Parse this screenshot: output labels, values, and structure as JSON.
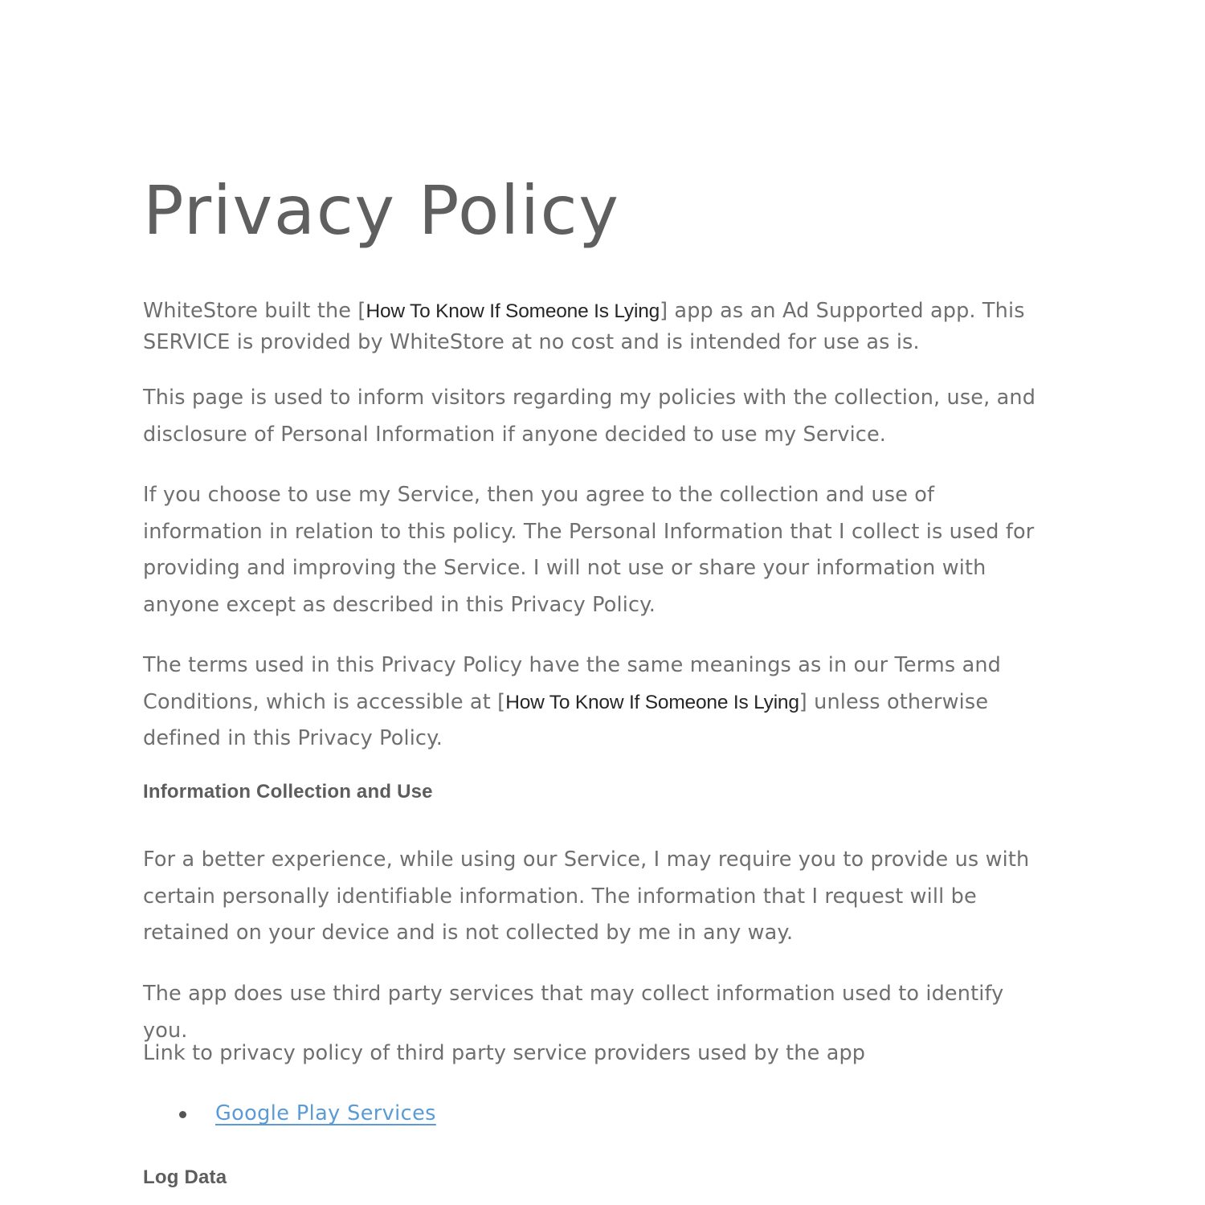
{
  "document": {
    "title": "Privacy Policy",
    "app_name": "How To Know If Someone Is Lying",
    "company": "WhiteStore",
    "colors": {
      "background": "#ffffff",
      "title": "#5f5f5f",
      "body_text": "#6f6f6f",
      "heading": "#5d5d5d",
      "app_name_text": "#262626",
      "link": "#5b9bd5",
      "bullet": "#555555"
    }
  },
  "paragraphs": {
    "intro_before": "WhiteStore built the [",
    "intro_after": "] app as an Ad Supported app. This SERVICE is provided by WhiteStore at no cost and is intended for use as is.",
    "p_inform": "This page is used to inform visitors regarding my policies with the collection, use, and disclosure of Personal Information if anyone decided to use my Service.",
    "p_choose": "If you choose to use my Service, then you agree to the collection and use of information in relation to this policy. The Personal Information that I collect is used for providing and improving the Service. I will not use or share your information with anyone except as described in this Privacy Policy.",
    "p_terms_before": "The terms used in this Privacy Policy have the same meanings as in our Terms and Conditions, which is accessible at [",
    "p_terms_after": "] unless otherwise defined in this Privacy Policy.",
    "p_better_experience": "For a better experience, while using our Service, I may require you to provide us with certain personally identifiable information. The information that I request will be retained on your device and is not collected by me in any way.",
    "p_third_party": "The app does use third party services that may collect information used to identify you.",
    "p_link_intro": "Link to privacy policy of third party service providers used by the app"
  },
  "headings": {
    "information_collection": "Information Collection and Use",
    "log_data": "Log Data"
  },
  "links": {
    "google_play_services": "Google Play Services"
  }
}
